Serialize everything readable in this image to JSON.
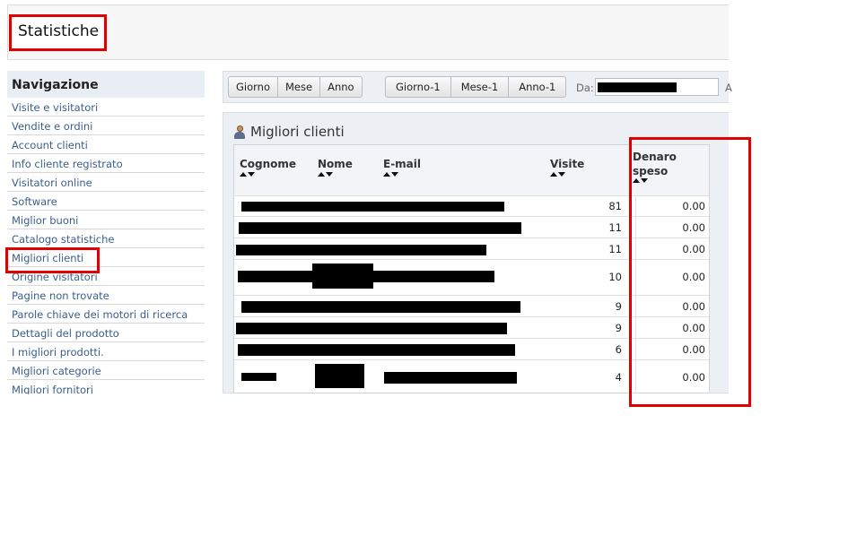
{
  "header": {
    "title": "Statistiche"
  },
  "sidebar": {
    "heading": "Navigazione",
    "items": [
      {
        "label": "Visite e visitatori"
      },
      {
        "label": "Vendite e ordini"
      },
      {
        "label": "Account clienti"
      },
      {
        "label": "Info cliente registrato"
      },
      {
        "label": "Visitatori online"
      },
      {
        "label": "Software"
      },
      {
        "label": "Miglior buoni"
      },
      {
        "label": "Catalogo statistiche"
      },
      {
        "label": "Migliori clienti"
      },
      {
        "label": "Origine visitatori"
      },
      {
        "label": "Pagine non trovate"
      },
      {
        "label": "Parole chiave dei motori di ricerca"
      },
      {
        "label": "Dettagli del prodotto"
      },
      {
        "label": "I migliori prodotti."
      },
      {
        "label": "Migliori categorie"
      },
      {
        "label": "Migliori fornitori"
      }
    ]
  },
  "toolbar": {
    "group1": [
      "Giorno",
      "Mese",
      "Anno"
    ],
    "group2": [
      "Giorno-1",
      "Mese-1",
      "Anno-1"
    ],
    "from_label": "Da:",
    "cut_label": "A"
  },
  "panel": {
    "title": "Migliori clienti",
    "columns": {
      "cognome": "Cognome",
      "nome": "Nome",
      "email": "E-mail",
      "visite": "Visite",
      "denaro_line1": "Denaro",
      "denaro_line2": "speso"
    },
    "rows": [
      {
        "visite": "81",
        "denaro": "0.00"
      },
      {
        "visite": "11",
        "denaro": "0.00"
      },
      {
        "visite": "11",
        "denaro": "0.00"
      },
      {
        "visite": "10",
        "denaro": "0.00"
      },
      {
        "visite": "9",
        "denaro": "0.00"
      },
      {
        "visite": "9",
        "denaro": "0.00"
      },
      {
        "visite": "6",
        "denaro": "0.00"
      },
      {
        "visite": "4",
        "denaro": "0.00"
      }
    ]
  },
  "colors": {
    "highlight": "#e00000",
    "link": "#3a5f8a",
    "redaction": "#000000"
  }
}
